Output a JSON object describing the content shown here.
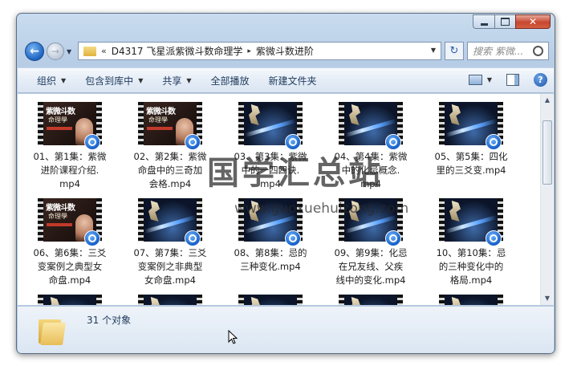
{
  "window": {
    "caption": {
      "close_glyph": "✕"
    }
  },
  "address_bar": {
    "prefix": "«",
    "crumbs": [
      "D4317 飞星派紫微斗数命理学",
      "紫微斗数进阶"
    ],
    "crumb_arrow": "▸",
    "search_placeholder": "搜索 紫微..."
  },
  "toolbar": {
    "organize": "组织",
    "include_in_library": "包含到库中",
    "share": "共享",
    "play_all": "全部播放",
    "new_folder": "新建文件夹"
  },
  "files": [
    {
      "name": "01、第1集：紫微进阶课程介绍.mp4",
      "line1": "01、第1集：紫微",
      "line2": "进阶课程介绍.",
      "line3": "mp4",
      "poster": "teacher"
    },
    {
      "name": "02、第2集：紫微命盘中的三奇加会格.mp4",
      "line1": "02、第2集：紫微",
      "line2": "命盘中的三奇加",
      "line3": "会格.mp4",
      "poster": "teacher"
    },
    {
      "name": "03、第3集：紫微中的一四四诀.mp4",
      "line1": "03、第3集：紫微",
      "line2": "中的一四四诀.",
      "line3": "mp4",
      "poster": "starry"
    },
    {
      "name": "04、第4集：紫微中的化忌概念.mp4",
      "line1": "04、第4集：紫微",
      "line2": "中的化忌概念.",
      "line3": "mp4",
      "poster": "starry"
    },
    {
      "name": "05、第5集：四化里的三爻变.mp4",
      "line1": "05、第5集：四化",
      "line2": "里的三爻变.mp4",
      "line3": "",
      "poster": "starry"
    },
    {
      "name": "06、第6集：三爻变案例之典型女命盘.mp4",
      "line1": "06、第6集：三爻",
      "line2": "变案例之典型女",
      "line3": "命盘.mp4",
      "poster": "teacher"
    },
    {
      "name": "07、第7集：三爻变案例之非典型女命盘.mp4",
      "line1": "07、第7集：三爻",
      "line2": "变案例之非典型",
      "line3": "女命盘.mp4",
      "poster": "starry"
    },
    {
      "name": "08、第8集：忌的三种变化.mp4",
      "line1": "08、第8集：忌的",
      "line2": "三种变化.mp4",
      "line3": "",
      "poster": "starry"
    },
    {
      "name": "09、第9集：化忌在兄友线、父疾线中的变化.mp4",
      "line1": "09、第9集：化忌",
      "line2": "在兄友线、父疾",
      "line3": "线中的变化.mp4",
      "poster": "starry"
    },
    {
      "name": "10、第10集：忌的三种变化中的格局.mp4",
      "line1": "10、第10集：忌",
      "line2": "的三种变化中的",
      "line3": "格局.mp4",
      "poster": "starry"
    }
  ],
  "poster_text": {
    "title": "紫微斗数",
    "subtitle": "命理學"
  },
  "status": {
    "count": "31 个对象"
  },
  "watermark": {
    "main": "国学汇总站",
    "url": "www.guoxuehuizong.com"
  },
  "colors": {
    "window_frame": "#b7cde6",
    "toolbar": "#e5edf7",
    "badge": "#1560c9",
    "close_button": "#c7472f"
  }
}
